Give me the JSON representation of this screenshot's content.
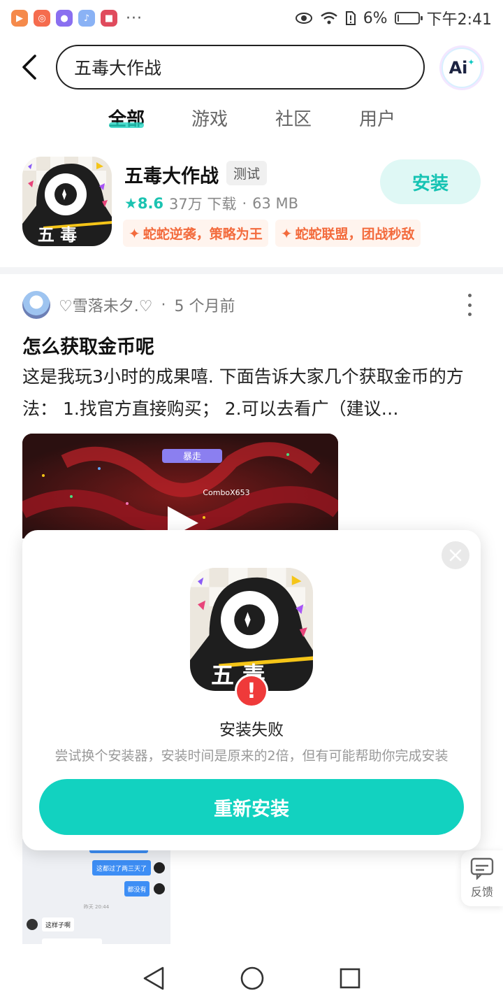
{
  "status_bar": {
    "battery_percent": "6%",
    "time": "下午2:41",
    "battery_level": 0.06,
    "left_icons": [
      "video-app-icon",
      "game-app-icon",
      "messenger-app-icon",
      "music-app-icon",
      "recorder-app-icon"
    ],
    "right_icons": [
      "eye-icon",
      "wifi-icon",
      "sim-alert-icon",
      "battery-icon"
    ]
  },
  "search": {
    "query": "五毒大作战",
    "ai_label": "Ai"
  },
  "tabs": [
    {
      "label": "全部",
      "active": true
    },
    {
      "label": "游戏",
      "active": false
    },
    {
      "label": "社区",
      "active": false
    },
    {
      "label": "用户",
      "active": false
    }
  ],
  "app": {
    "name": "五毒大作战",
    "tag": "测试",
    "rating": "8.6",
    "downloads": "37万 下载",
    "size": "63 MB",
    "highlights": [
      "蛇蛇逆袭，策略为王",
      "蛇蛇联盟，团战秒敌"
    ],
    "install_label": "安装",
    "icon_text": "五 毒",
    "accent_color": "#12d2c0"
  },
  "post": {
    "author": "♡雪落未夕.♡",
    "time": "5 个月前",
    "title": "怎么获取金币呢",
    "body": "这是我玩3小时的成果嘻. 下面告诉大家几个获取金币的方法： 1.找官方直接购买； 2.可以去看广（建议…",
    "video_label": "暴走",
    "combo_text": "ComboX653",
    "chat_messages": [
      "这都过了两三天了",
      "都没有",
      "这样子啊"
    ],
    "chat_time": "昨天 20:44"
  },
  "feedback": {
    "label": "反馈"
  },
  "dialog": {
    "title": "安装失败",
    "subtitle": "尝试换个安装器，安装时间是原来的2倍，但有可能帮助你完成安装",
    "button_label": "重新安装",
    "error_mark": "!",
    "icon_text": "五 毒",
    "error_color": "#ef3a3a"
  },
  "navbar": {
    "icons": [
      "back-triangle-icon",
      "home-circle-icon",
      "recents-square-icon"
    ]
  }
}
